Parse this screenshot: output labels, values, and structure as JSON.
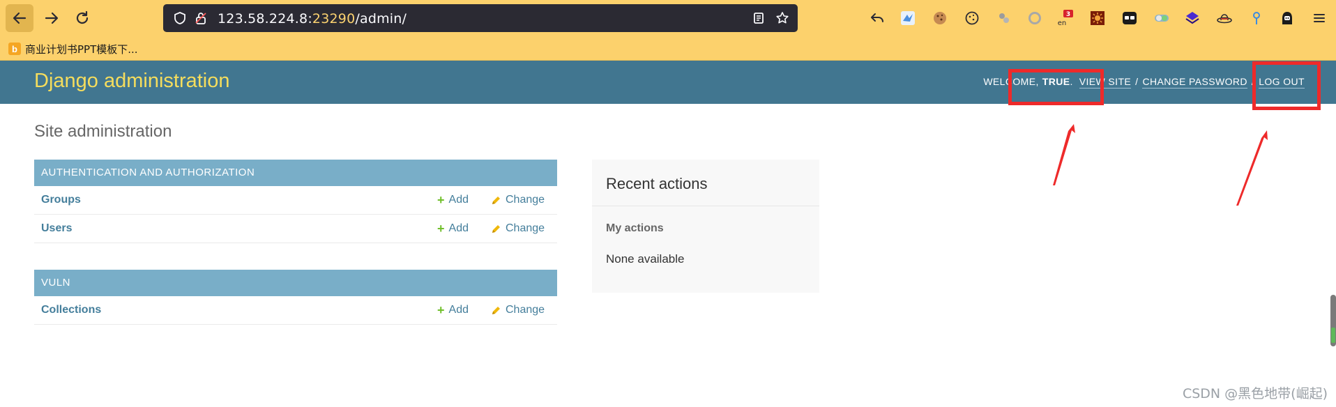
{
  "browser": {
    "url_host": "123.58.224.8:",
    "url_port": "23290",
    "url_path": "/admin/",
    "bookmark_label": "商业计划书PPT模板下...",
    "bookmark_favicon_letter": "b",
    "extension_badge_count": "3",
    "extension_badge_sub": "en",
    "icons": [
      "back-icon",
      "forward-icon",
      "reload-icon",
      "shield-icon",
      "lock-icon",
      "reader-mode-icon",
      "bookmark-star-icon",
      "undo-icon",
      "bird-extension-icon",
      "cookie-icon",
      "cookie-outline-icon",
      "translate-icon",
      "ring-icon",
      "language-badge-icon",
      "sun-extension-icon",
      "glasses-extension-icon",
      "toggle-extension-icon",
      "layers-extension-icon",
      "hat-extension-icon",
      "pin-extension-icon",
      "hacker-extension-icon",
      "menu-icon"
    ],
    "colors": {
      "toolbar": "#fcd16c",
      "urlbar": "#2b2a33",
      "port": "#fbd270"
    }
  },
  "header": {
    "branding": "Django administration",
    "welcome": "WELCOME,",
    "username": "TRUE",
    "welcome_end": ".",
    "view_site": "VIEW SITE",
    "separator": "/",
    "change_password": "CHANGE PASSWORD",
    "log_out": "LOG OUT",
    "colors": {
      "background": "#417690",
      "branding": "#f5dd5d"
    }
  },
  "content": {
    "heading": "Site administration",
    "modules": [
      {
        "caption": "AUTHENTICATION AND AUTHORIZATION",
        "models": [
          {
            "name": "Groups",
            "add": "Add",
            "change": "Change"
          },
          {
            "name": "Users",
            "add": "Add",
            "change": "Change"
          }
        ]
      },
      {
        "caption": "VULN",
        "models": [
          {
            "name": "Collections",
            "add": "Add",
            "change": "Change"
          }
        ]
      }
    ],
    "recent": {
      "title": "Recent actions",
      "subtitle": "My actions",
      "empty": "None available"
    },
    "colors": {
      "caption": "#79aec8",
      "link": "#447e9b",
      "add_icon": "#70bf2b",
      "change_icon": "#efb80b"
    }
  },
  "watermark": "CSDN @黑色地带(崛起)",
  "annotations": {
    "color": "#ee2a2a",
    "boxes": 2,
    "arrows": 2
  }
}
